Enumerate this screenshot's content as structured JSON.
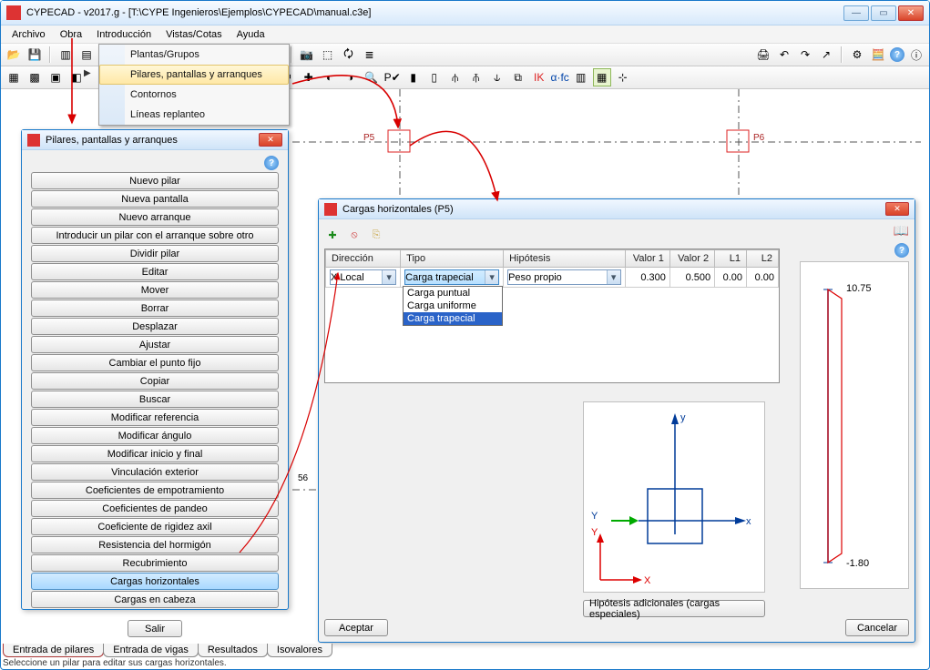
{
  "title": "CYPECAD - v2017.g - [T:\\CYPE Ingenieros\\Ejemplos\\CYPECAD\\manual.c3e]",
  "menubar": [
    "Archivo",
    "Obra",
    "Introducción",
    "Vistas/Cotas",
    "Ayuda"
  ],
  "dropdown": {
    "items": [
      "Plantas/Grupos",
      "Pilares, pantallas y arranques",
      "Contornos",
      "Líneas replanteo"
    ],
    "highlight": 1
  },
  "tabs": [
    "Entrada de pilares",
    "Entrada de vigas",
    "Resultados",
    "Isovalores"
  ],
  "statusbar": "Seleccione un pilar para editar sus cargas horizontales.",
  "pillars_panel": {
    "title": "Pilares, pantallas y arranques",
    "buttons": [
      "Nuevo pilar",
      "Nueva pantalla",
      "Nuevo arranque",
      "Introducir un pilar con el arranque sobre otro",
      "Dividir pilar",
      "Editar",
      "Mover",
      "Borrar",
      "Desplazar",
      "Ajustar",
      "Cambiar el punto fijo",
      "Copiar",
      "Buscar",
      "Modificar referencia",
      "Modificar ángulo",
      "Modificar inicio y final",
      "Vinculación exterior",
      "Coeficientes de empotramiento",
      "Coeficientes de pandeo",
      "Coeficiente de rigidez axil",
      "Resistencia del hormigón",
      "Recubrimiento",
      "Cargas horizontales",
      "Cargas en cabeza"
    ],
    "selected": 22,
    "exit": "Salir"
  },
  "cargas": {
    "title": "Cargas horizontales (P5)",
    "headers": [
      "Dirección",
      "Tipo",
      "Hipótesis",
      "Valor 1",
      "Valor 2",
      "L1",
      "L2"
    ],
    "row": {
      "direccion": "X Local",
      "tipo": "Carga trapecial",
      "hipotesis": "Peso propio",
      "v1": "0.300",
      "v2": "0.500",
      "l1": "0.00",
      "l2": "0.00"
    },
    "dd_options": [
      "Carga puntual",
      "Carga uniforme",
      "Carga trapecial"
    ],
    "dd_highlight": 2,
    "side_top": "10.75",
    "side_bot": "-1.80",
    "axis": {
      "y": "Y",
      "x": "X",
      "yy": "y",
      "xx": "x"
    },
    "hyp_btn": "Hipótesis adicionales (cargas especiales)",
    "ok": "Aceptar",
    "cancel": "Cancelar"
  },
  "canvas_labels": {
    "p5": "P5",
    "p6": "P6",
    "p56": "56"
  }
}
